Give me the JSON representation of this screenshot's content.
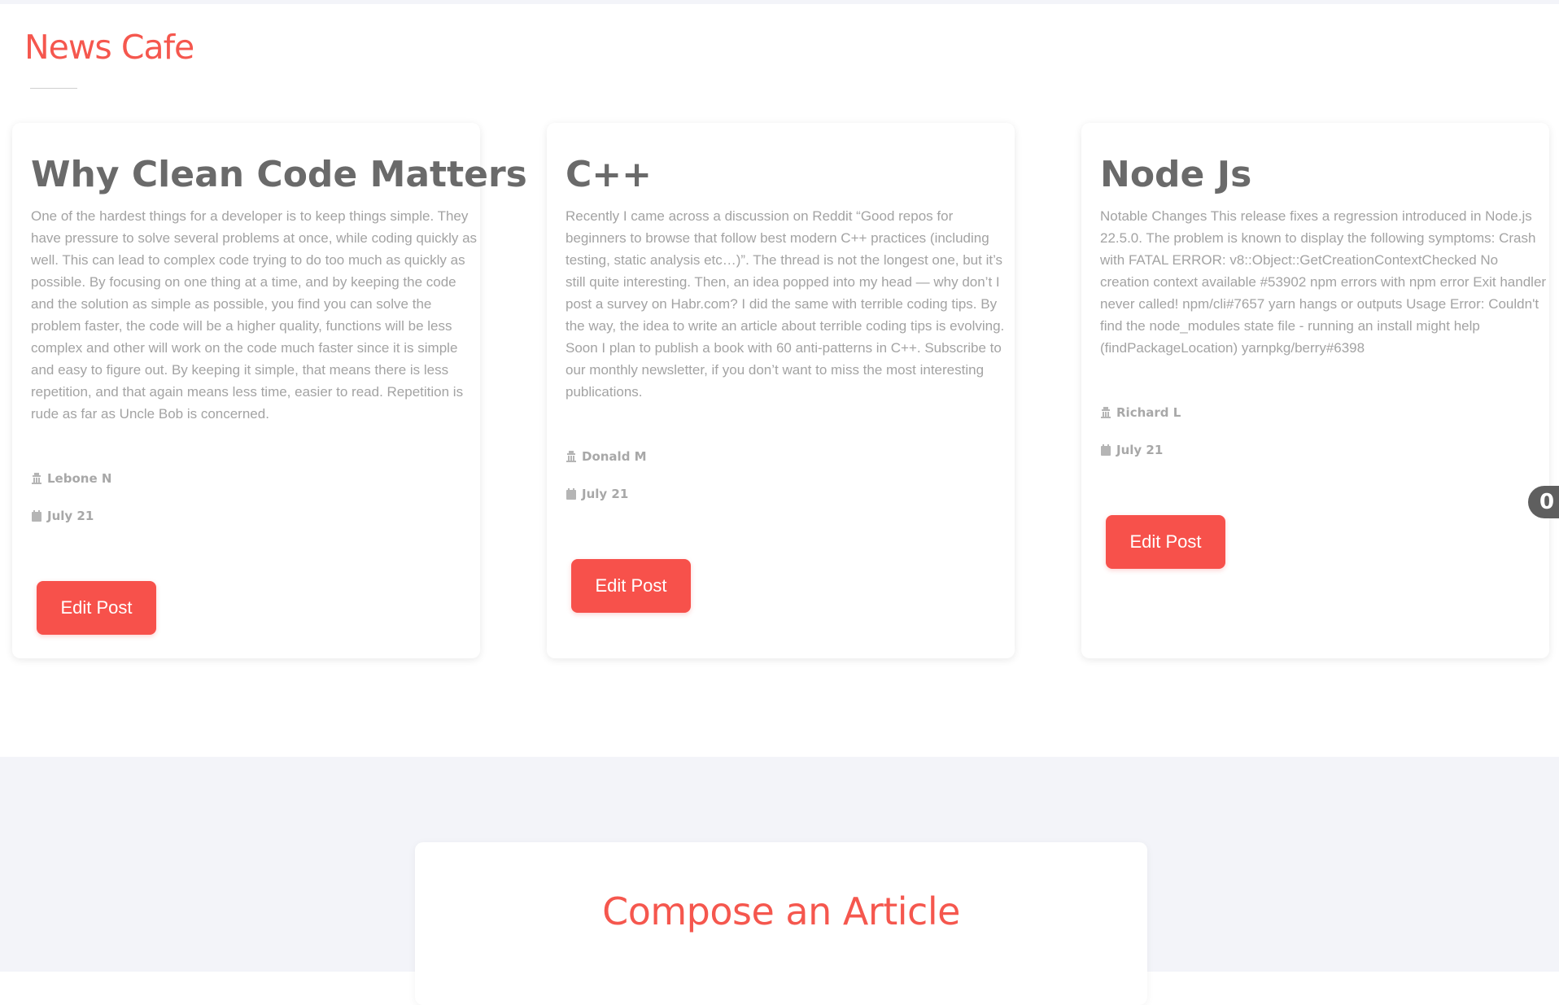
{
  "header": {
    "brand": "News Cafe"
  },
  "posts": [
    {
      "title": "Why Clean Code Matters",
      "body": "One of the hardest things for a developer is to keep things simple. They have pressure to solve several problems at once, while coding quickly as well. This can lead to complex code trying to do too much as quickly as possible. By focusing on one thing at a time, and by keeping the code and the solution as simple as possible, you find you can solve the problem faster, the code will be a higher quality, functions will be less complex and other will work on the code much faster since it is simple and easy to figure out. By keeping it simple, that means there is less repetition, and that again means less time, easier to read. Repetition is rude as far as Uncle Bob is concerned.",
      "author": "Lebone N",
      "date": "July 21",
      "button_label": "Edit Post"
    },
    {
      "title": "C++",
      "body": "Recently I came across a discussion on Reddit “Good repos for beginners to browse that follow best modern C++ practices (including testing, static analysis etc…)”. The thread is not the longest one, but it’s still quite interesting. Then, an idea popped into my head — why don’t I post a survey on Habr.com? I did the same with terrible coding tips. By the way, the idea to write an article about terrible coding tips is evolving. Soon I plan to publish a book with 60 anti-patterns in C++. Subscribe to our monthly newsletter, if you don’t want to miss the most interesting publications.",
      "author": "Donald M",
      "date": "July 21",
      "button_label": "Edit Post"
    },
    {
      "title": "Node Js",
      "body": "Notable Changes This release fixes a regression introduced in Node.js 22.5.0. The problem is known to display the following symptoms: Crash with FATAL ERROR: v8::Object::GetCreationContextChecked No creation context available #53902 npm errors with npm error Exit handler never called! npm/cli#7657 yarn hangs or outputs Usage Error: Couldn't find the node_modules state file - running an install might help (findPackageLocation) yarnpkg/berry#6398",
      "author": "Richard L",
      "date": "July 21",
      "button_label": "Edit Post"
    }
  ],
  "side_badge": {
    "text": "0"
  },
  "compose": {
    "title": "Compose an Article"
  },
  "icons": {
    "author": "author-icon",
    "date": "calendar-icon"
  },
  "colors": {
    "accent": "#f5574e",
    "button": "#f7514b",
    "title_text": "#6a6a6a",
    "body_text": "#a3a3a3",
    "section_bg": "#f3f4f9"
  }
}
